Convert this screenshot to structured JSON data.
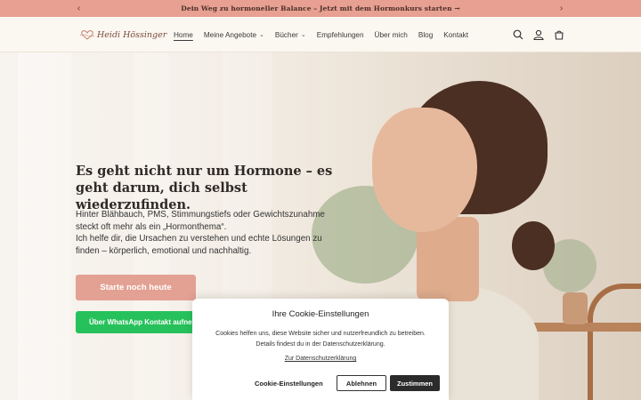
{
  "announcement": {
    "message": "Dein Weg zu hormoneller Balance – Jetzt mit dem Hormonkurs starten →",
    "prev_icon": "chevron-left-icon",
    "next_icon": "chevron-right-icon"
  },
  "header": {
    "logo_text": "Heidi Hössinger",
    "nav": [
      {
        "label": "Home",
        "active": true,
        "dropdown": false
      },
      {
        "label": "Meine Angebote",
        "active": false,
        "dropdown": true
      },
      {
        "label": "Bücher",
        "active": false,
        "dropdown": true
      },
      {
        "label": "Empfehlungen",
        "active": false,
        "dropdown": false
      },
      {
        "label": "Über mich",
        "active": false,
        "dropdown": false
      },
      {
        "label": "Blog",
        "active": false,
        "dropdown": false
      },
      {
        "label": "Kontakt",
        "active": false,
        "dropdown": false
      }
    ],
    "icons": [
      "search-icon",
      "account-icon",
      "cart-icon"
    ]
  },
  "hero": {
    "title": "Es geht nicht nur um Hormone – es geht darum, dich selbst wiederzufinden.",
    "text_1": "Hinter Blähbauch, PMS, Stimmungstiefs oder Gewichtszunahme steckt oft mehr als ein „Hormonthema“.",
    "text_2": "Ich helfe dir, die Ursachen zu verstehen und echte Lösungen zu finden – körperlich, emotional und nachhaltig.",
    "cta_label": "Starte noch heute",
    "whatsapp_label": "Über WhatsApp Kontakt aufnehmen"
  },
  "cookie": {
    "title": "Ihre Cookie-Einstellungen",
    "text": "Cookies helfen uns, diese Website sicher und nutzerfreundlich zu betreiben. Details findest du in der Datenschutzerklärung.",
    "link": "Zur Datenschutzerklärung",
    "settings_label": "Cookie-Einstellungen",
    "decline_label": "Ablehnen",
    "accept_label": "Zustimmen"
  },
  "colors": {
    "announcement_bg": "#e7a092",
    "cta_bg": "#e3a193",
    "whatsapp_bg": "#27c15b",
    "accept_bg": "#2b2b2b"
  }
}
